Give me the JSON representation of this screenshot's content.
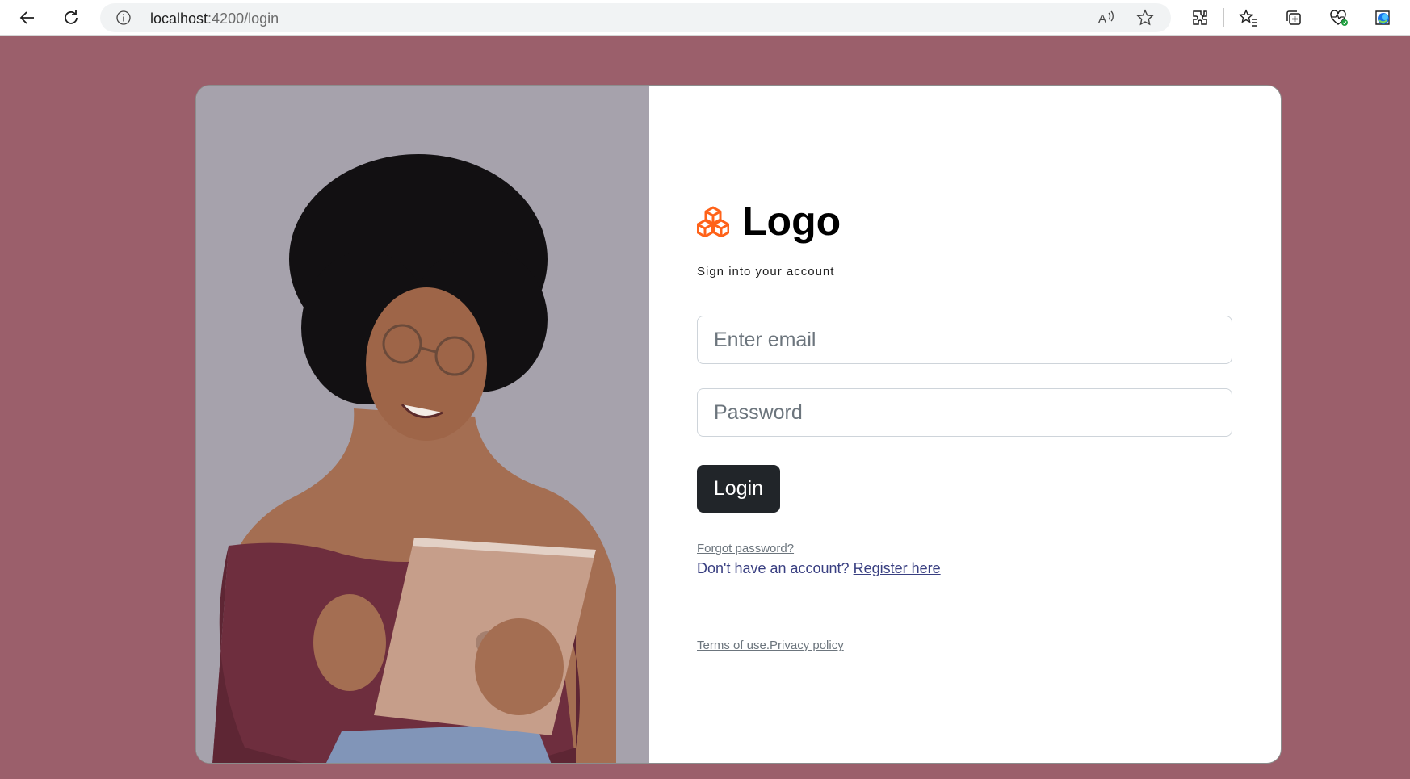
{
  "browser": {
    "url_host": "localhost",
    "url_path": ":4200/login"
  },
  "login": {
    "logo_text": "Logo",
    "subtitle": "Sign into your account",
    "email_placeholder": "Enter email",
    "password_placeholder": "Password",
    "login_button": "Login",
    "forgot_password": "Forgot password?",
    "no_account_text": "Don't have an account? ",
    "register_link": "Register here",
    "terms_link": "Terms of use.",
    "privacy_link": "Privacy policy"
  },
  "colors": {
    "page_background": "#9b5f6b",
    "logo_accent": "#ff6219",
    "button_dark": "#212529"
  },
  "icons": [
    "back-arrow-icon",
    "refresh-icon",
    "info-icon",
    "read-aloud-icon",
    "favorite-star-icon",
    "extensions-icon",
    "favorites-icon",
    "collections-icon",
    "health-icon",
    "edge-icon",
    "cubes-logo-icon"
  ]
}
